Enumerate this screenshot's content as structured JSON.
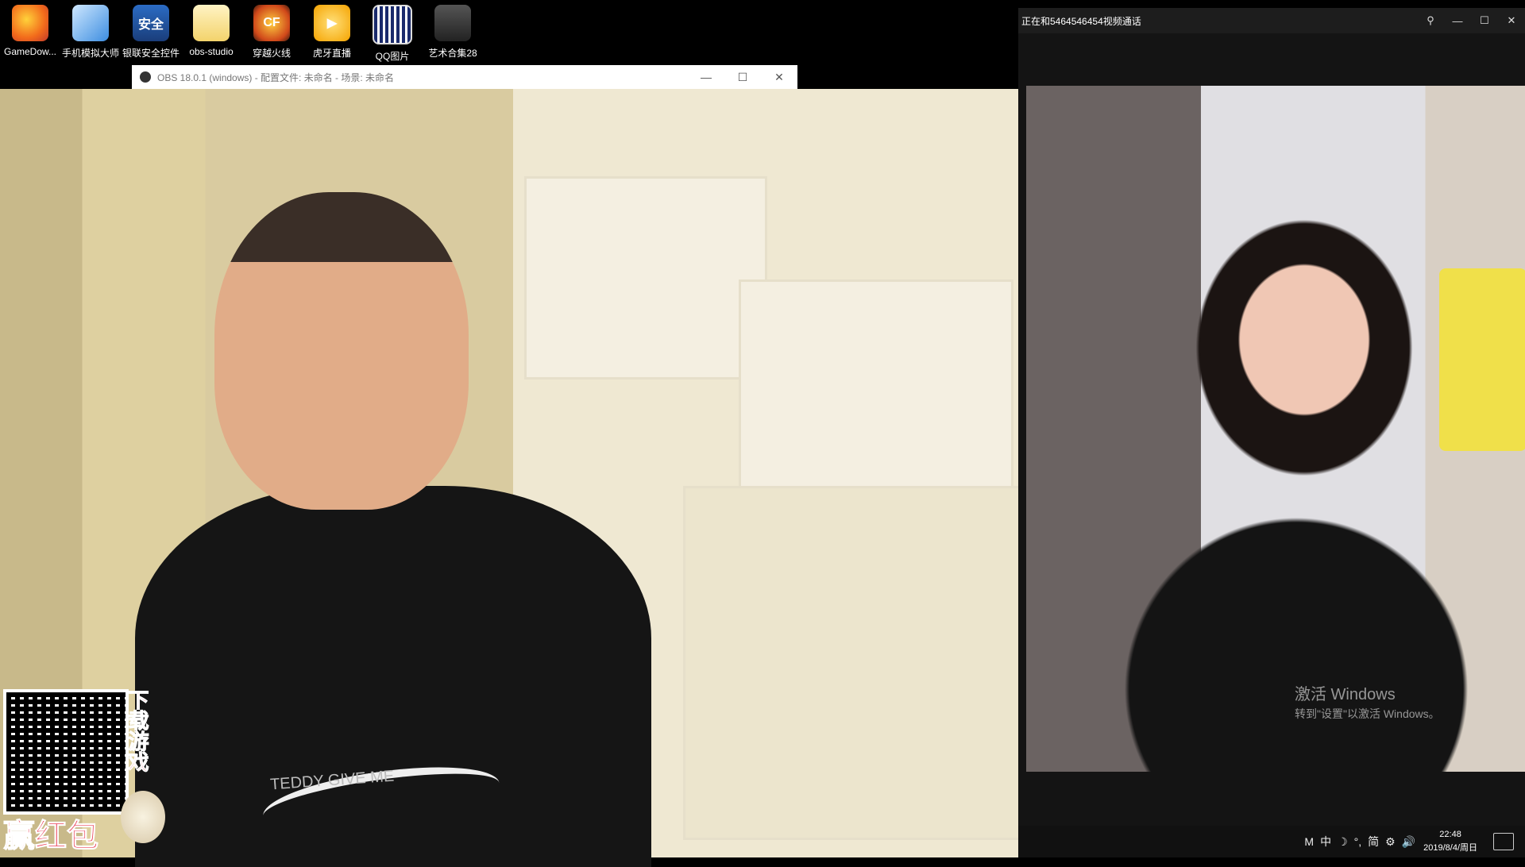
{
  "desktop": {
    "icons": [
      {
        "label": "GameDow...",
        "icon": "game-icon"
      },
      {
        "label": "手机模拟大师",
        "icon": "phone-emulator-icon"
      },
      {
        "label": "银联安全控件",
        "icon": "shield-icon"
      },
      {
        "label": "obs-studio",
        "icon": "folder-icon"
      },
      {
        "label": "穿越火线",
        "icon": "crossfire-icon"
      },
      {
        "label": "虎牙直播",
        "icon": "huya-icon"
      },
      {
        "label": "QQ图片",
        "icon": "qr-image-icon"
      },
      {
        "label": "艺术合集28",
        "icon": "art-collection-icon"
      }
    ]
  },
  "obs": {
    "title": "OBS 18.0.1 (windows) - 配置文件: 未命名 - 场景: 未命名",
    "min": "—",
    "max": "☐",
    "close": "✕"
  },
  "call": {
    "title": "正在和5464546454视频通话",
    "pin": "⚲",
    "min": "—",
    "max": "☐",
    "close": "✕"
  },
  "watermark": {
    "line1": "激活 Windows",
    "line2": "转到\"设置\"以激活 Windows。"
  },
  "overlay": {
    "side_text": "下载游戏",
    "bottom_text": "赢红包",
    "shirt_text": "TEDDY GIVE ME"
  },
  "taskbar": {
    "ime": "M",
    "lang": "中",
    "moon": "☽",
    "punct": "°,",
    "simp": "简",
    "gear": "⚙",
    "time": "22:48",
    "date": "2019/8/4/周日",
    "volume": "🔊"
  }
}
